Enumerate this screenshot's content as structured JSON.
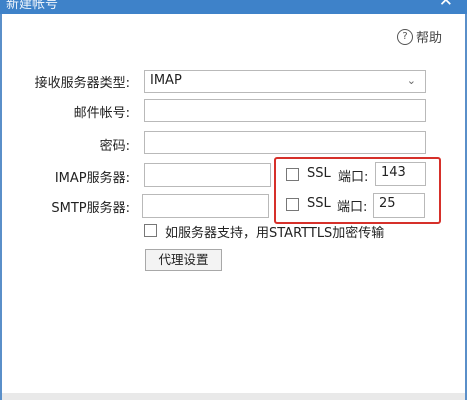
{
  "window": {
    "title": "新建帐号",
    "close_glyph": "✕"
  },
  "help": {
    "label": "帮助",
    "icon": "question-circle-icon",
    "icon_glyph": "?"
  },
  "form": {
    "receive_type": {
      "label": "接收服务器类型:",
      "value": "IMAP",
      "arrow": "⌄"
    },
    "account": {
      "label": "邮件帐号:",
      "value": ""
    },
    "password": {
      "label": "密码:",
      "value": ""
    },
    "imap": {
      "label": "IMAP服务器:",
      "value": "",
      "ssl_label": "SSL",
      "ssl_checked": false,
      "port_label": "端口:",
      "port": "143"
    },
    "smtp": {
      "label": "SMTP服务器:",
      "value": "",
      "ssl_label": "SSL",
      "ssl_checked": false,
      "port_label": "端口:",
      "port": "25"
    },
    "starttls": {
      "label": "如服务器支持，用STARTTLS加密传输",
      "checked": false
    },
    "proxy_button": "代理设置"
  },
  "colors": {
    "titlebar": "#3e82c9",
    "highlight": "#d6302a"
  }
}
